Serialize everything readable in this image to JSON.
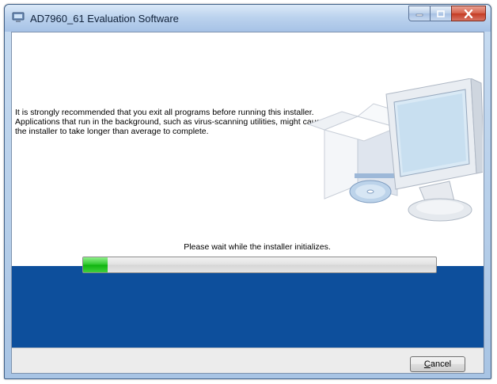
{
  "window": {
    "title": "AD7960_61 Evaluation Software",
    "icon": "installer-app-icon",
    "caption_buttons": [
      "minimize-icon",
      "maximize-icon",
      "close-icon"
    ]
  },
  "main": {
    "message": "It is strongly recommended that you exit all programs before running this installer. Applications that run in the background, such as virus-scanning utilities, might cause the installer to take longer than average to complete.",
    "status": "Please wait while the installer initializes.",
    "progress_fraction": 0.07,
    "illustration": "computer-with-box-and-disc"
  },
  "footer": {
    "cancel_first": "C",
    "cancel_rest": "ancel"
  },
  "colors": {
    "blue_band": "#0d4f9c",
    "progress_green": "#1cba1b",
    "close_red": "#c43b23"
  }
}
